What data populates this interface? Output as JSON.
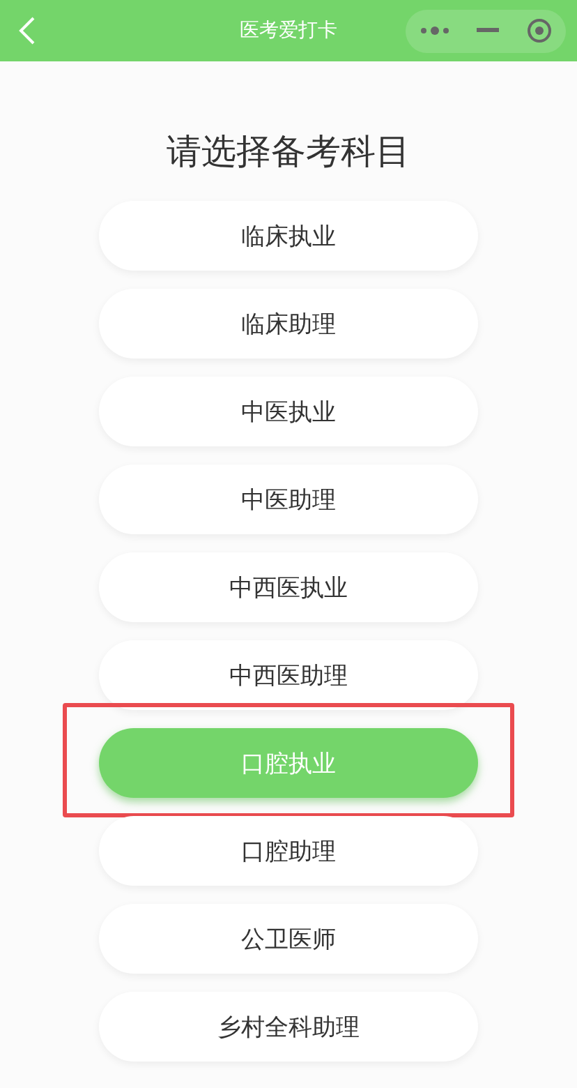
{
  "nav_bar": {
    "title": "医考爱打卡"
  },
  "heading": "请选择备考科目",
  "subjects": [
    {
      "label": "临床执业",
      "selected": false,
      "highlighted": false
    },
    {
      "label": "临床助理",
      "selected": false,
      "highlighted": false
    },
    {
      "label": "中医执业",
      "selected": false,
      "highlighted": false
    },
    {
      "label": "中医助理",
      "selected": false,
      "highlighted": false
    },
    {
      "label": "中西医执业",
      "selected": false,
      "highlighted": false
    },
    {
      "label": "中西医助理",
      "selected": false,
      "highlighted": false
    },
    {
      "label": "口腔执业",
      "selected": true,
      "highlighted": true
    },
    {
      "label": "口腔助理",
      "selected": false,
      "highlighted": false
    },
    {
      "label": "公卫医师",
      "selected": false,
      "highlighted": false
    },
    {
      "label": "乡村全科助理",
      "selected": false,
      "highlighted": false
    }
  ]
}
